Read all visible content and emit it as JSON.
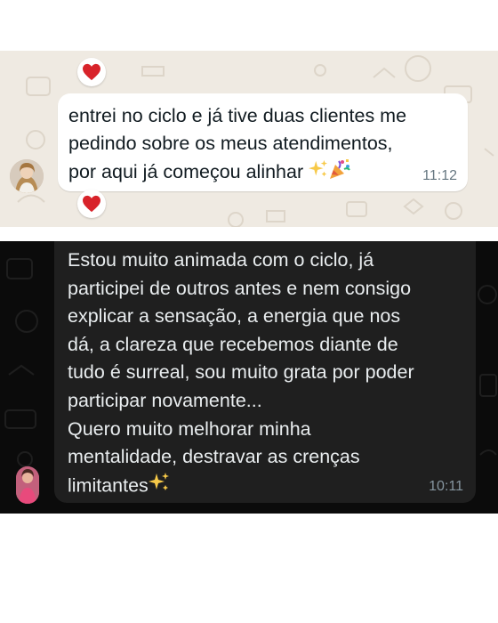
{
  "light_chat": {
    "message": "entrei no ciclo e já tive duas clientes me\npedindo sobre os meus atendimentos,\npor aqui já começou alinhar",
    "emojis": [
      "sparkles-icon",
      "party-popper-icon"
    ],
    "time": "11:12",
    "reactions": [
      "heart-icon",
      "heart-icon"
    ],
    "background": "#efeae2",
    "bubble_color": "#ffffff"
  },
  "dark_chat": {
    "message": "Estou muito animada com o ciclo, já\nparticipei de outros antes e nem consigo\nexplicar a sensação, a energia que nos\ndá, a clareza que recebemos diante de\ntudo é surreal, sou muito grata por poder\nparticipar novamente...\nQuero muito melhorar minha\nmentalidade, destravar as crenças\nlimitantes",
    "emoji": "sparkles-icon",
    "time": "10:11",
    "background": "#0b0b0b",
    "bubble_color": "#1f1f1f"
  }
}
